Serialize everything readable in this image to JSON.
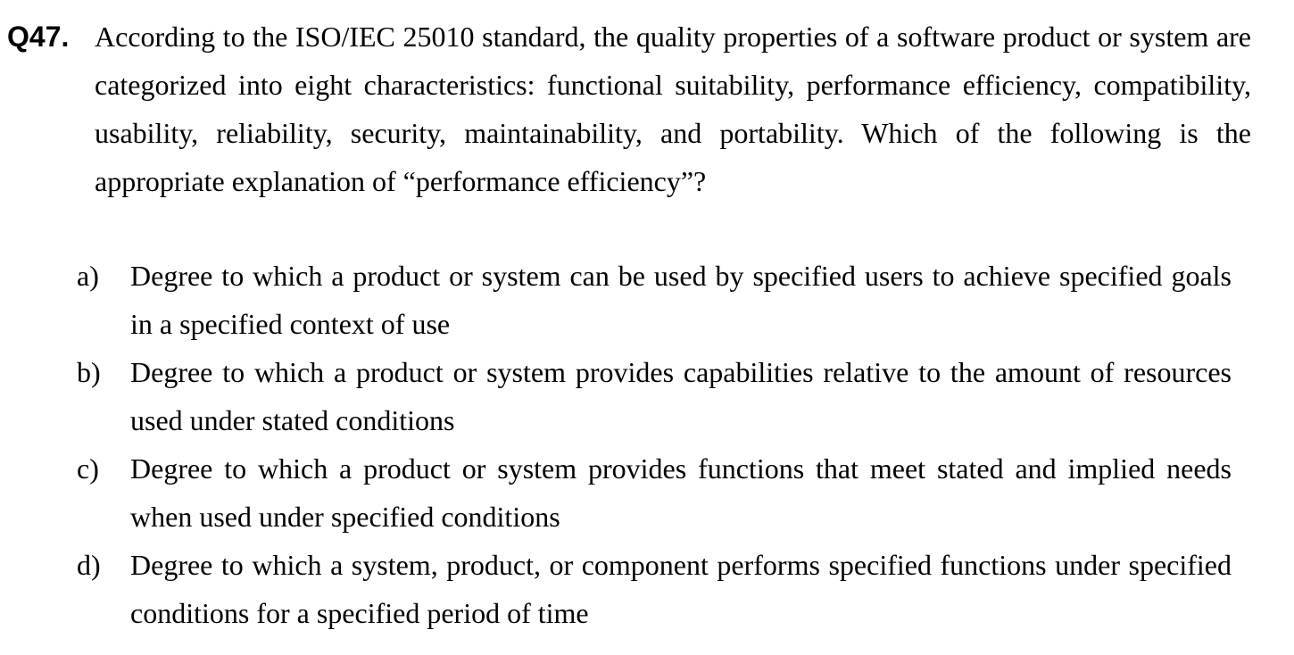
{
  "question": {
    "number": "Q47.",
    "text": "According to the ISO/IEC 25010 standard, the quality properties of a software product or system are categorized into eight characteristics: functional suitability, performance efficiency, compatibility, usability, reliability, security, maintainability, and portability. Which of the following is the appropriate explanation of “performance efficiency”?"
  },
  "options": [
    {
      "letter": "a)",
      "text": "Degree to which a product or system can be used by specified users to achieve specified goals in a specified context of use"
    },
    {
      "letter": "b)",
      "text": "Degree to which a product or system provides capabilities relative to the amount of resources used under stated conditions"
    },
    {
      "letter": "c)",
      "text": "Degree to which a product or system provides functions that meet stated and implied needs when used under specified conditions"
    },
    {
      "letter": "d)",
      "text": "Degree to which a system, product, or component performs specified functions under specified conditions for a specified period of time"
    }
  ]
}
